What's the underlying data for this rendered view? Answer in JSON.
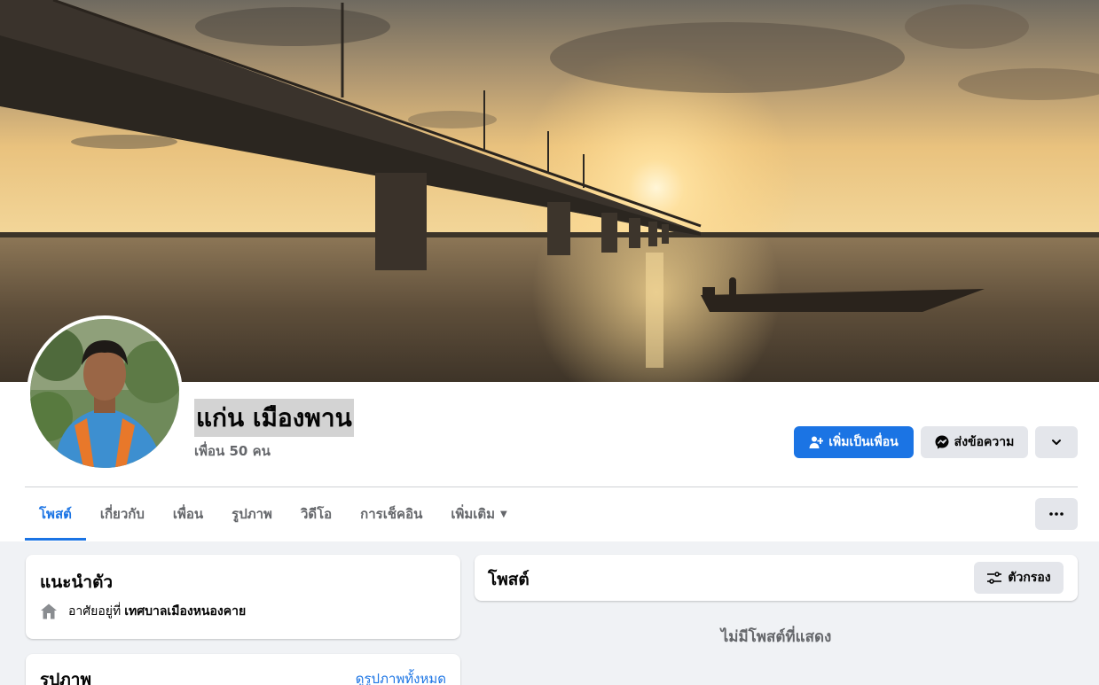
{
  "profile": {
    "name": "แก่น เมืองพาน",
    "friends_count": "เพื่อน 50 คน"
  },
  "actions": {
    "add_friend": "เพิ่มเป็นเพื่อน",
    "message": "ส่งข้อความ"
  },
  "tabs": [
    {
      "label": "โพสต์"
    },
    {
      "label": "เกี่ยวกับ"
    },
    {
      "label": "เพื่อน"
    },
    {
      "label": "รูปภาพ"
    },
    {
      "label": "วิดีโอ"
    },
    {
      "label": "การเช็คอิน"
    },
    {
      "label": "เพิ่มเติม"
    }
  ],
  "intro": {
    "title": "แนะนำตัว",
    "lives_in_prefix": "อาศัยอยู่ที่",
    "lives_in_place": "เทศบาลเมืองหนองคาย"
  },
  "photos": {
    "title": "รูปภาพ",
    "see_all": "ดูรูปภาพทั้งหมด"
  },
  "posts": {
    "title": "โพสต์",
    "filter": "ตัวกรอง",
    "empty": "ไม่มีโพสต์ที่แสดง"
  },
  "colors": {
    "accent": "#1b74e4",
    "secondary_bg": "#e4e6eb",
    "page_bg": "#f0f2f5",
    "muted_text": "#65676b"
  }
}
